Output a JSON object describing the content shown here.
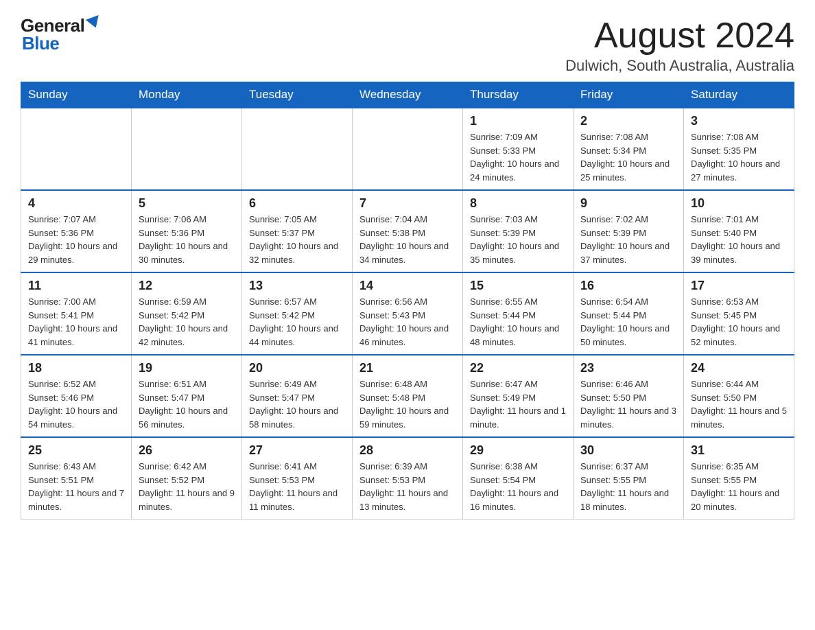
{
  "logo": {
    "general": "General",
    "blue": "Blue"
  },
  "title": "August 2024",
  "location": "Dulwich, South Australia, Australia",
  "days_of_week": [
    "Sunday",
    "Monday",
    "Tuesday",
    "Wednesday",
    "Thursday",
    "Friday",
    "Saturday"
  ],
  "weeks": [
    [
      {
        "day": "",
        "info": ""
      },
      {
        "day": "",
        "info": ""
      },
      {
        "day": "",
        "info": ""
      },
      {
        "day": "",
        "info": ""
      },
      {
        "day": "1",
        "info": "Sunrise: 7:09 AM\nSunset: 5:33 PM\nDaylight: 10 hours and 24 minutes."
      },
      {
        "day": "2",
        "info": "Sunrise: 7:08 AM\nSunset: 5:34 PM\nDaylight: 10 hours and 25 minutes."
      },
      {
        "day": "3",
        "info": "Sunrise: 7:08 AM\nSunset: 5:35 PM\nDaylight: 10 hours and 27 minutes."
      }
    ],
    [
      {
        "day": "4",
        "info": "Sunrise: 7:07 AM\nSunset: 5:36 PM\nDaylight: 10 hours and 29 minutes."
      },
      {
        "day": "5",
        "info": "Sunrise: 7:06 AM\nSunset: 5:36 PM\nDaylight: 10 hours and 30 minutes."
      },
      {
        "day": "6",
        "info": "Sunrise: 7:05 AM\nSunset: 5:37 PM\nDaylight: 10 hours and 32 minutes."
      },
      {
        "day": "7",
        "info": "Sunrise: 7:04 AM\nSunset: 5:38 PM\nDaylight: 10 hours and 34 minutes."
      },
      {
        "day": "8",
        "info": "Sunrise: 7:03 AM\nSunset: 5:39 PM\nDaylight: 10 hours and 35 minutes."
      },
      {
        "day": "9",
        "info": "Sunrise: 7:02 AM\nSunset: 5:39 PM\nDaylight: 10 hours and 37 minutes."
      },
      {
        "day": "10",
        "info": "Sunrise: 7:01 AM\nSunset: 5:40 PM\nDaylight: 10 hours and 39 minutes."
      }
    ],
    [
      {
        "day": "11",
        "info": "Sunrise: 7:00 AM\nSunset: 5:41 PM\nDaylight: 10 hours and 41 minutes."
      },
      {
        "day": "12",
        "info": "Sunrise: 6:59 AM\nSunset: 5:42 PM\nDaylight: 10 hours and 42 minutes."
      },
      {
        "day": "13",
        "info": "Sunrise: 6:57 AM\nSunset: 5:42 PM\nDaylight: 10 hours and 44 minutes."
      },
      {
        "day": "14",
        "info": "Sunrise: 6:56 AM\nSunset: 5:43 PM\nDaylight: 10 hours and 46 minutes."
      },
      {
        "day": "15",
        "info": "Sunrise: 6:55 AM\nSunset: 5:44 PM\nDaylight: 10 hours and 48 minutes."
      },
      {
        "day": "16",
        "info": "Sunrise: 6:54 AM\nSunset: 5:44 PM\nDaylight: 10 hours and 50 minutes."
      },
      {
        "day": "17",
        "info": "Sunrise: 6:53 AM\nSunset: 5:45 PM\nDaylight: 10 hours and 52 minutes."
      }
    ],
    [
      {
        "day": "18",
        "info": "Sunrise: 6:52 AM\nSunset: 5:46 PM\nDaylight: 10 hours and 54 minutes."
      },
      {
        "day": "19",
        "info": "Sunrise: 6:51 AM\nSunset: 5:47 PM\nDaylight: 10 hours and 56 minutes."
      },
      {
        "day": "20",
        "info": "Sunrise: 6:49 AM\nSunset: 5:47 PM\nDaylight: 10 hours and 58 minutes."
      },
      {
        "day": "21",
        "info": "Sunrise: 6:48 AM\nSunset: 5:48 PM\nDaylight: 10 hours and 59 minutes."
      },
      {
        "day": "22",
        "info": "Sunrise: 6:47 AM\nSunset: 5:49 PM\nDaylight: 11 hours and 1 minute."
      },
      {
        "day": "23",
        "info": "Sunrise: 6:46 AM\nSunset: 5:50 PM\nDaylight: 11 hours and 3 minutes."
      },
      {
        "day": "24",
        "info": "Sunrise: 6:44 AM\nSunset: 5:50 PM\nDaylight: 11 hours and 5 minutes."
      }
    ],
    [
      {
        "day": "25",
        "info": "Sunrise: 6:43 AM\nSunset: 5:51 PM\nDaylight: 11 hours and 7 minutes."
      },
      {
        "day": "26",
        "info": "Sunrise: 6:42 AM\nSunset: 5:52 PM\nDaylight: 11 hours and 9 minutes."
      },
      {
        "day": "27",
        "info": "Sunrise: 6:41 AM\nSunset: 5:53 PM\nDaylight: 11 hours and 11 minutes."
      },
      {
        "day": "28",
        "info": "Sunrise: 6:39 AM\nSunset: 5:53 PM\nDaylight: 11 hours and 13 minutes."
      },
      {
        "day": "29",
        "info": "Sunrise: 6:38 AM\nSunset: 5:54 PM\nDaylight: 11 hours and 16 minutes."
      },
      {
        "day": "30",
        "info": "Sunrise: 6:37 AM\nSunset: 5:55 PM\nDaylight: 11 hours and 18 minutes."
      },
      {
        "day": "31",
        "info": "Sunrise: 6:35 AM\nSunset: 5:55 PM\nDaylight: 11 hours and 20 minutes."
      }
    ]
  ]
}
